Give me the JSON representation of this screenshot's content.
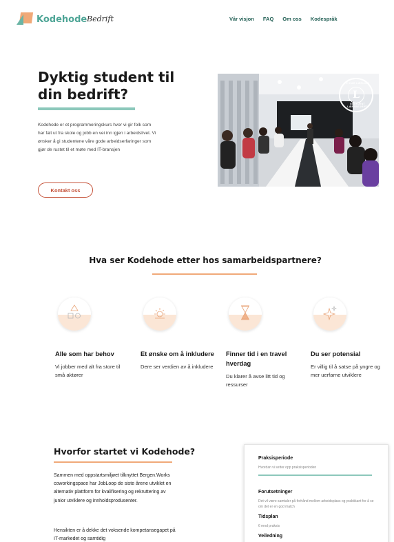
{
  "header": {
    "logo_text": "Kodehode",
    "logo_sub": "Bedrift",
    "nav": [
      "Vår visjon",
      "FAQ",
      "Om oss",
      "Kodespråk"
    ]
  },
  "hero": {
    "title": "Dyktig student til din bedrift?",
    "text": "Kodehode er et programmeringskurs hvor vi gir folk som har falt ut fra skole og jobb en vei inn igjen i arbeidslivet. Vi ønsker å gi studentene våre gode arbeidserfaringer som gjør de rustet til et møte med IT-bransjen",
    "button": "Kontakt oss",
    "seal_letter": "L",
    "seal_top": "VI HAR LÆRLING",
    "seal_bottom": "GODKJENT LÆREBEDRIFT"
  },
  "partners": {
    "title": "Hva ser Kodehode etter hos samarbeidspartnere?",
    "features": [
      {
        "icon": "shapes-icon",
        "title": "Alle som har behov",
        "text": "Vi jobber med alt fra store til små aktører"
      },
      {
        "icon": "sun-icon",
        "title": "Et ønske om å inkludere",
        "text": "Dere ser verdien av å inkludere"
      },
      {
        "icon": "hourglass-icon",
        "title": "Finner tid i en travel hverdag",
        "text": "Du klarer å avse litt tid og ressurser"
      },
      {
        "icon": "sparkle-icon",
        "title": "Du ser potensial",
        "text": "Er villig til å satse på yngre og mer uerfarne utviklere"
      }
    ]
  },
  "why": {
    "title": "Hvorfor startet vi Kodehode?",
    "p1": "Sammen med oppstartsmiljøet tilknyttet Bergen.Works coworkingspace har JobLoop de siste årene utviklet en alternativ plattform for kvalifisering og rekruttering av junior utviklere og innholdsprodusenter.",
    "p2": "Hensikten er å dekke det voksende kompetansegapet på IT-markedet og samtidig"
  },
  "card": {
    "title": "Praksisperiode",
    "subtitle": "Hvordan vi setter opp praksisperioden",
    "items": [
      {
        "h": "Forutsetninger",
        "s": "Det vil være samtaler på forhånd mellom arbeidsplass og praktikant for å se om det er en god match"
      },
      {
        "h": "Tidsplan",
        "s": "6 mnd praksis"
      },
      {
        "h": "Veiledning",
        "s": ""
      }
    ]
  }
}
